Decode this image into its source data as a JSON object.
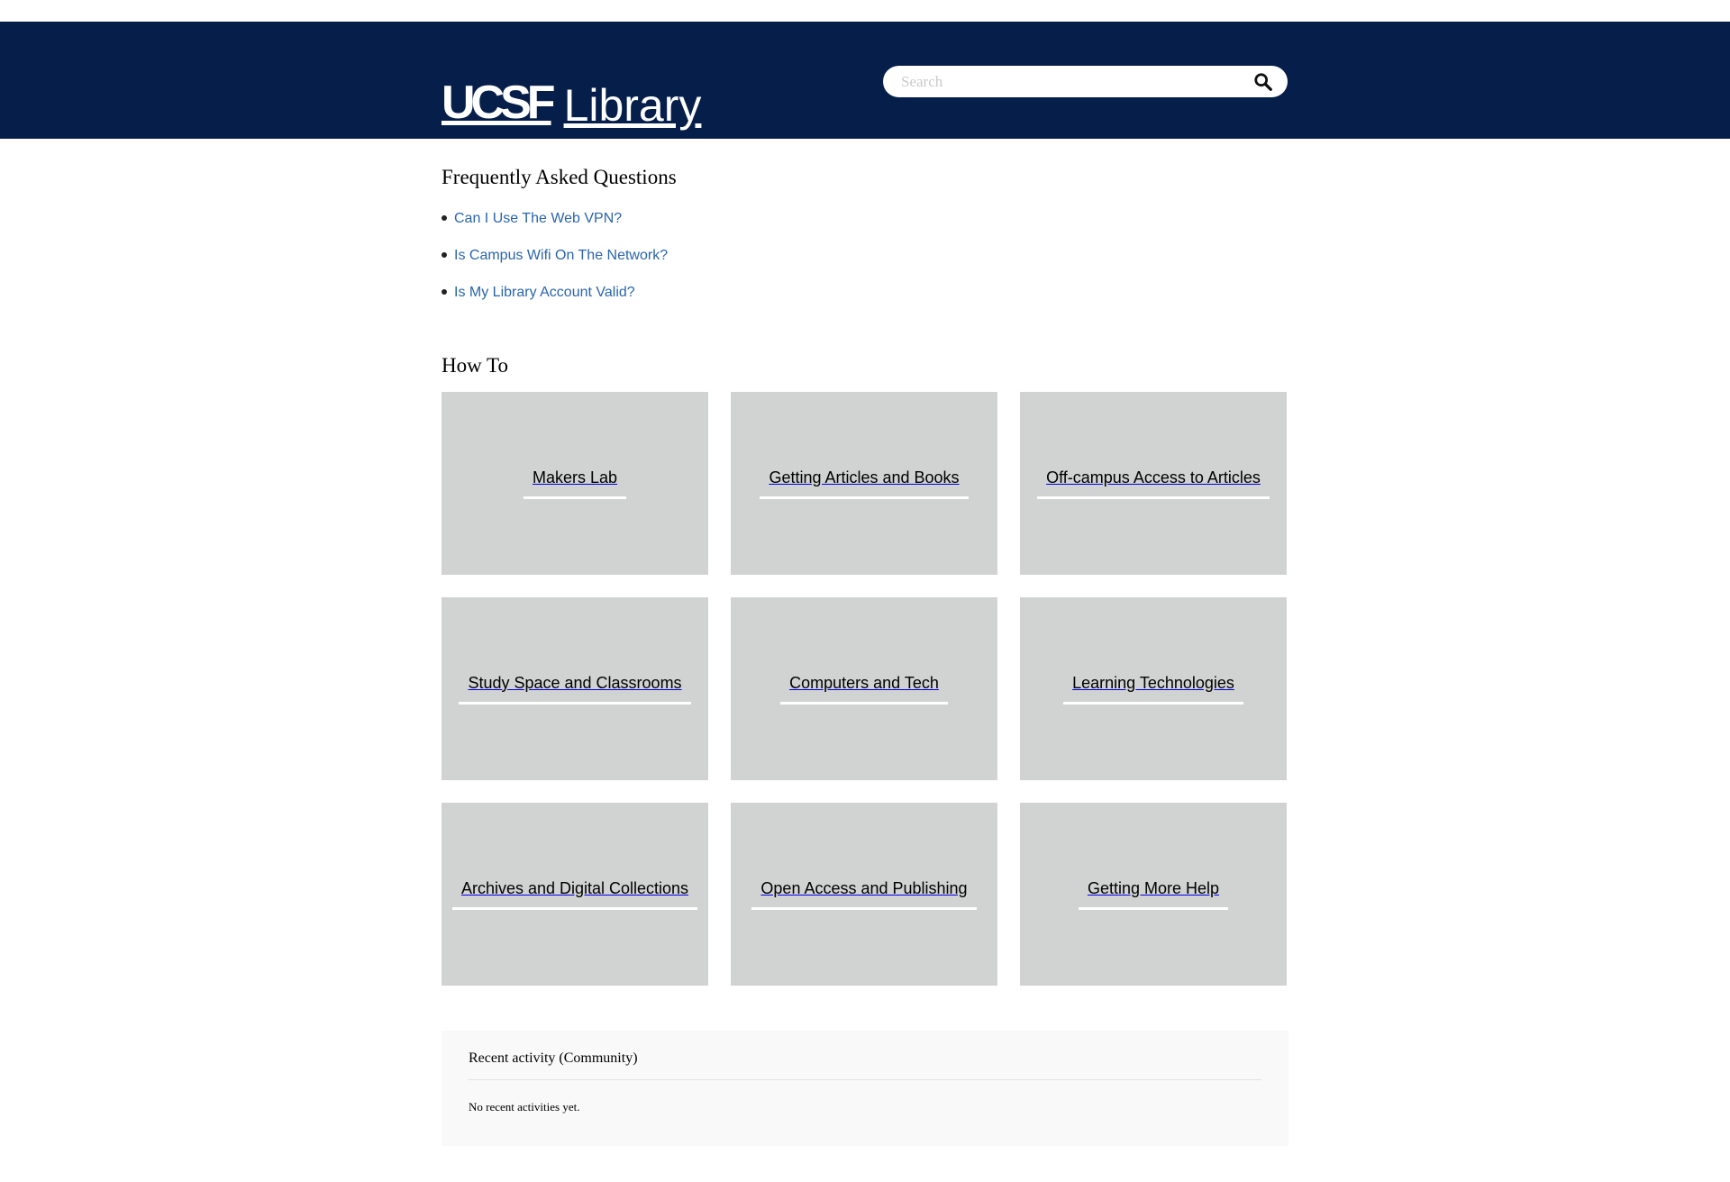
{
  "header": {
    "logo_ucsf": "UCSF",
    "logo_library": "Library",
    "search": {
      "placeholder": "Search",
      "value": "",
      "icon": "search-icon"
    }
  },
  "colors": {
    "header_bg": "#061f4a",
    "link": "#2a65ad",
    "tile_bg": "#d1d2d2",
    "recent_bg": "#f9f9f9"
  },
  "faq": {
    "title": "Frequently Asked Questions",
    "items": [
      {
        "label": "Can I Use The Web VPN?"
      },
      {
        "label": "Is Campus Wifi On The Network?"
      },
      {
        "label": "Is My Library Account Valid?"
      }
    ]
  },
  "howto": {
    "title": "How To",
    "tiles": [
      {
        "label": "Makers Lab"
      },
      {
        "label": "Getting Articles and Books"
      },
      {
        "label": "Off-campus Access to Articles"
      },
      {
        "label": "Study Space and Classrooms"
      },
      {
        "label": "Computers and Tech"
      },
      {
        "label": "Learning Technologies"
      },
      {
        "label": "Archives and Digital Collections"
      },
      {
        "label": "Open Access and Publishing"
      },
      {
        "label": "Getting More Help"
      }
    ]
  },
  "recent": {
    "title": "Recent activity (Community)",
    "empty_text": "No recent activities yet."
  }
}
